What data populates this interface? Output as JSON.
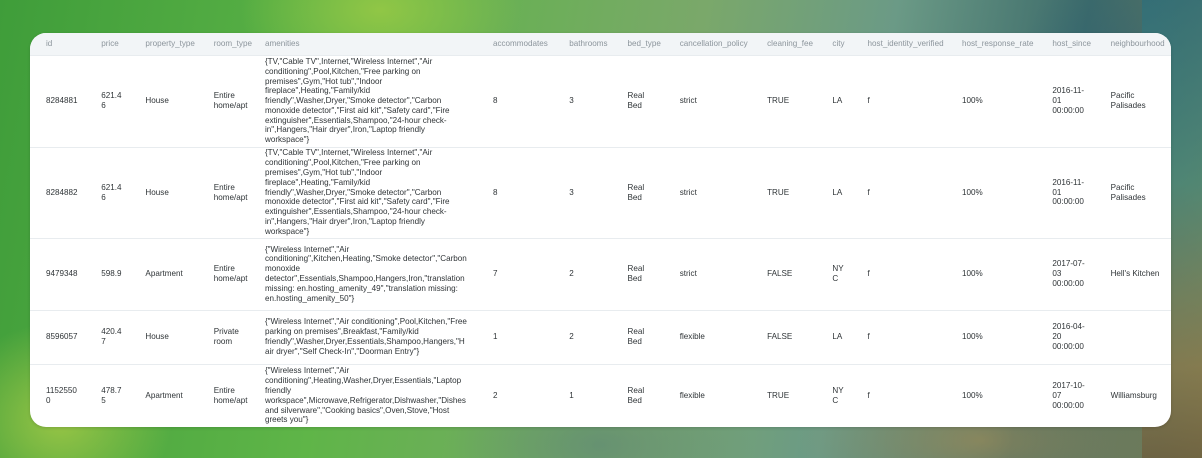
{
  "columns": [
    "id",
    "price",
    "property_type",
    "room_type",
    "amenities",
    "accommodates",
    "bathrooms",
    "bed_type",
    "cancellation_policy",
    "cleaning_fee",
    "city",
    "host_identity_verified",
    "host_response_rate",
    "host_since",
    "neighbourhood"
  ],
  "rows": [
    {
      "id": "8284881",
      "price": "621.46",
      "property_type": "House",
      "room_type": "Entire home/apt",
      "amenities": "{TV,\"Cable TV\",Internet,\"Wireless Internet\",\"Air conditioning\",Pool,Kitchen,\"Free parking on premises\",Gym,\"Hot tub\",\"Indoor fireplace\",Heating,\"Family/kid friendly\",Washer,Dryer,\"Smoke detector\",\"Carbon monoxide detector\",\"First aid kit\",\"Safety card\",\"Fire extinguisher\",Essentials,Shampoo,\"24-hour check-in\",Hangers,\"Hair dryer\",Iron,\"Laptop friendly workspace\"}",
      "accommodates": "8",
      "bathrooms": "3",
      "bed_type": "Real Bed",
      "cancellation_policy": "strict",
      "cleaning_fee": "TRUE",
      "city": "LA",
      "host_identity_verified": "f",
      "host_response_rate": "100%",
      "host_since": "2016-11-01 00:00:00",
      "neighbourhood": "Pacific Palisades"
    },
    {
      "id": "8284882",
      "price": "621.46",
      "property_type": "House",
      "room_type": "Entire home/apt",
      "amenities": "{TV,\"Cable TV\",Internet,\"Wireless Internet\",\"Air conditioning\",Pool,Kitchen,\"Free parking on premises\",Gym,\"Hot tub\",\"Indoor fireplace\",Heating,\"Family/kid friendly\",Washer,Dryer,\"Smoke detector\",\"Carbon monoxide detector\",\"First aid kit\",\"Safety card\",\"Fire extinguisher\",Essentials,Shampoo,\"24-hour check-in\",Hangers,\"Hair dryer\",Iron,\"Laptop friendly workspace\"}",
      "accommodates": "8",
      "bathrooms": "3",
      "bed_type": "Real Bed",
      "cancellation_policy": "strict",
      "cleaning_fee": "TRUE",
      "city": "LA",
      "host_identity_verified": "f",
      "host_response_rate": "100%",
      "host_since": "2016-11-01 00:00:00",
      "neighbourhood": "Pacific Palisades"
    },
    {
      "id": "9479348",
      "price": "598.9",
      "property_type": "Apartment",
      "room_type": "Entire home/apt",
      "amenities": "{\"Wireless Internet\",\"Air conditioning\",Kitchen,Heating,\"Smoke detector\",\"Carbon monoxide detector\",Essentials,Shampoo,Hangers,Iron,\"translation missing: en.hosting_amenity_49\",\"translation missing: en.hosting_amenity_50\"}",
      "accommodates": "7",
      "bathrooms": "2",
      "bed_type": "Real Bed",
      "cancellation_policy": "strict",
      "cleaning_fee": "FALSE",
      "city": "NYC",
      "host_identity_verified": "f",
      "host_response_rate": "100%",
      "host_since": "2017-07-03 00:00:00",
      "neighbourhood": "Hell's Kitchen"
    },
    {
      "id": "8596057",
      "price": "420.47",
      "property_type": "House",
      "room_type": "Private room",
      "amenities": "{\"Wireless Internet\",\"Air conditioning\",Pool,Kitchen,\"Free parking on premises\",Breakfast,\"Family/kid friendly\",Washer,Dryer,Essentials,Shampoo,Hangers,\"Hair dryer\",\"Self Check-In\",\"Doorman Entry\"}",
      "accommodates": "1",
      "bathrooms": "2",
      "bed_type": "Real Bed",
      "cancellation_policy": "flexible",
      "cleaning_fee": "FALSE",
      "city": "LA",
      "host_identity_verified": "f",
      "host_response_rate": "100%",
      "host_since": "2016-04-20 00:00:00",
      "neighbourhood": ""
    },
    {
      "id": "11525500",
      "price": "478.75",
      "property_type": "Apartment",
      "room_type": "Entire home/apt",
      "amenities": "{\"Wireless Internet\",\"Air conditioning\",Heating,Washer,Dryer,Essentials,\"Laptop friendly workspace\",Microwave,Refrigerator,Dishwasher,\"Dishes and silverware\",\"Cooking basics\",Oven,Stove,\"Host greets you\"}",
      "accommodates": "2",
      "bathrooms": "1",
      "bed_type": "Real Bed",
      "cancellation_policy": "flexible",
      "cleaning_fee": "TRUE",
      "city": "NYC",
      "host_identity_verified": "f",
      "host_response_rate": "100%",
      "host_since": "2017-10-07 00:00:00",
      "neighbourhood": "Williamsburg"
    }
  ]
}
